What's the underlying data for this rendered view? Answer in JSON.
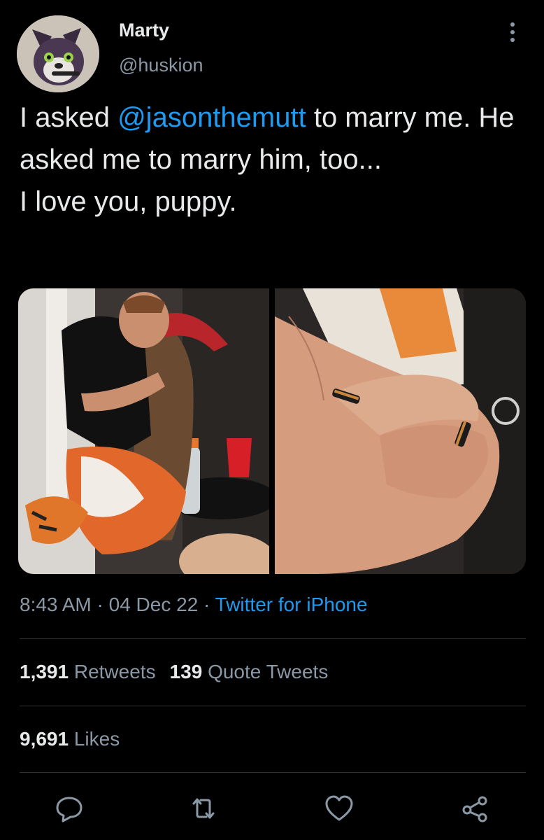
{
  "user": {
    "name": "Marty",
    "handle": "@huskion"
  },
  "tweet": {
    "text_before": "I asked ",
    "mention": "@jasonthemutt",
    "text_after": " to marry me. He asked me to marry him, too...",
    "line2": "I love you, puppy."
  },
  "meta": {
    "time": "8:43 AM",
    "sep1": " · ",
    "date": "04 Dec 22",
    "sep2": " · ",
    "source": "Twitter for iPhone"
  },
  "stats": {
    "retweets_count": "1,391",
    "retweets_label": "Retweets",
    "quotes_count": "139",
    "quotes_label": "Quote Tweets",
    "likes_count": "9,691",
    "likes_label": "Likes"
  },
  "icons": [
    "more-icon",
    "reply-icon",
    "retweet-icon",
    "like-icon",
    "share-icon"
  ],
  "colors": {
    "background": "#000000",
    "text": "#e7e9ea",
    "secondary": "#8b98a5",
    "link": "#1d9bf0",
    "divider": "#2f3336"
  }
}
